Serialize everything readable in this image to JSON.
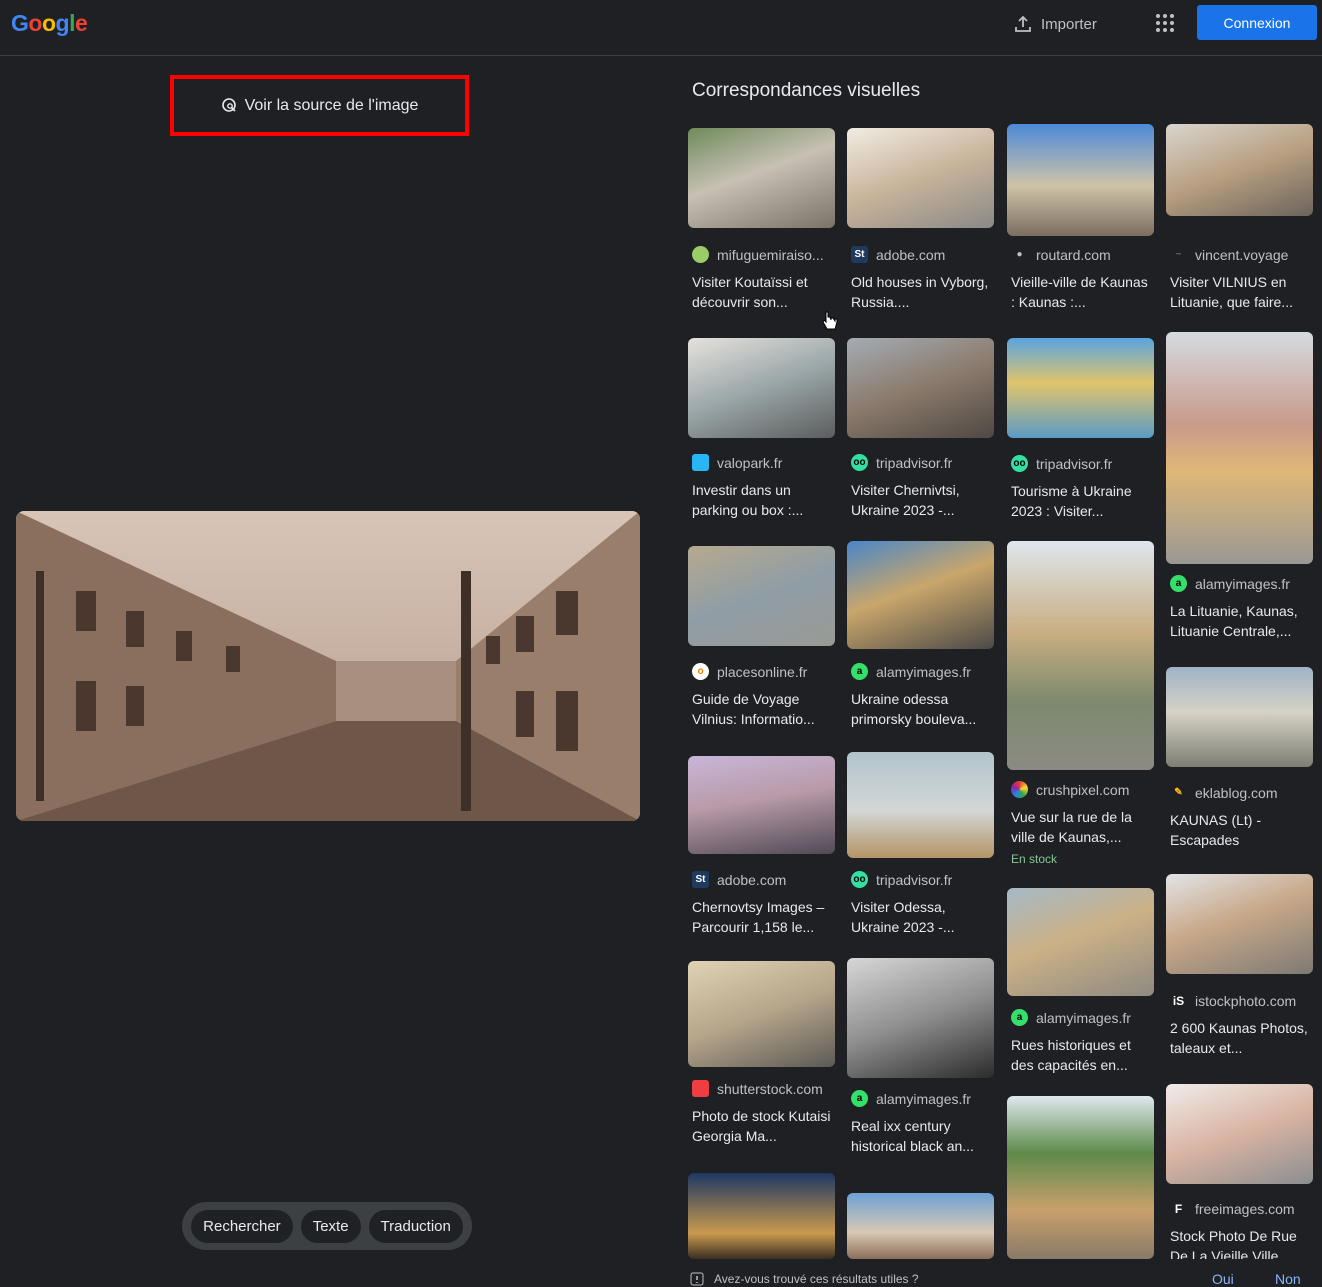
{
  "header": {
    "logo": "Google",
    "import_label": "Importer",
    "signin_label": "Connexion"
  },
  "left_panel": {
    "source_button": "Voir la source de l'image",
    "tools": [
      "Rechercher",
      "Texte",
      "Traduction"
    ]
  },
  "visual_matches": {
    "title": "Correspondances visuelles",
    "items": [
      {
        "site": "mifuguemiraiso...",
        "desc": "Visiter Koutaïssi et découvrir son..."
      },
      {
        "site": "adobe.com",
        "desc": "Old houses in Vyborg, Russia...."
      },
      {
        "site": "routard.com",
        "desc": "Vieille-ville de Kaunas : Kaunas :..."
      },
      {
        "site": "vincent.voyage",
        "desc": "Visiter VILNIUS en Lituanie, que faire..."
      },
      {
        "site": "valopark.fr",
        "desc": "Investir dans un parking ou box :..."
      },
      {
        "site": "tripadvisor.fr",
        "desc": "Visiter Chernivtsi, Ukraine 2023 -..."
      },
      {
        "site": "tripadvisor.fr",
        "desc": "Tourisme à Ukraine 2023 : Visiter..."
      },
      {
        "site": "alamyimages.fr",
        "desc": "La Lituanie, Kaunas, Lituanie Centrale,..."
      },
      {
        "site": "placesonline.fr",
        "desc": "Guide de Voyage Vilnius: Informatio..."
      },
      {
        "site": "alamyimages.fr",
        "desc": "Ukraine odessa primorsky bouleva..."
      },
      {
        "site": "crushpixel.com",
        "desc": "Vue sur la rue de la ville de Kaunas,...",
        "badge": "En stock"
      },
      {
        "site": "eklablog.com",
        "desc": "KAUNAS (Lt) - Escapades"
      },
      {
        "site": "adobe.com",
        "desc": "Chernovtsy Images – Parcourir 1,158 le..."
      },
      {
        "site": "tripadvisor.fr",
        "desc": "Visiter Odessa, Ukraine 2023 -..."
      },
      {
        "site": "alamyimages.fr",
        "desc": "Rues historiques et des capacités en..."
      },
      {
        "site": "istockphoto.com",
        "desc": "2 600 Kaunas Photos, taleaux et..."
      },
      {
        "site": "shutterstock.com",
        "desc": "Photo de stock Kutaisi Georgia Ma..."
      },
      {
        "site": "alamyimages.fr",
        "desc": "Real ixx century historical black an..."
      },
      {
        "site": "freeimages.com",
        "desc": "Stock Photo De Rue De La Vieille Ville..."
      }
    ]
  },
  "feedback": {
    "question": "Avez-vous trouvé ces résultats utiles ?",
    "yes": "Oui",
    "no": "Non"
  },
  "colors": {
    "background": "#1f2023",
    "accent": "#1a73e8",
    "highlight_frame": "#ff0000",
    "stock_green": "#81c995"
  }
}
